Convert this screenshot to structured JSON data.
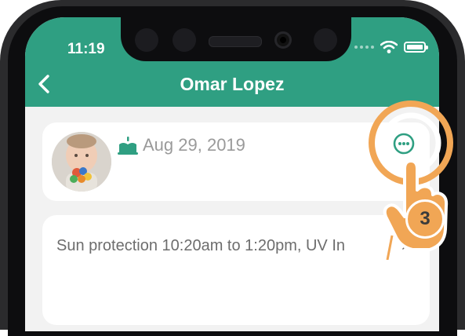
{
  "status_bar": {
    "time": "11:19"
  },
  "nav": {
    "title": "Omar Lopez"
  },
  "profile": {
    "birth_date": "Aug 29, 2019"
  },
  "note": {
    "text": "Sun protection 10:20am to 1:20pm, UV In",
    "close_label": "×"
  },
  "tutorial": {
    "step": "3"
  },
  "colors": {
    "header": "#2f9f82",
    "highlight": "#f1a655",
    "background": "#f2f2f2"
  },
  "icons": [
    "back-chevron-icon",
    "cake-icon",
    "more-options-icon",
    "wifi-icon",
    "battery-icon",
    "pointing-hand-icon",
    "close-icon"
  ]
}
